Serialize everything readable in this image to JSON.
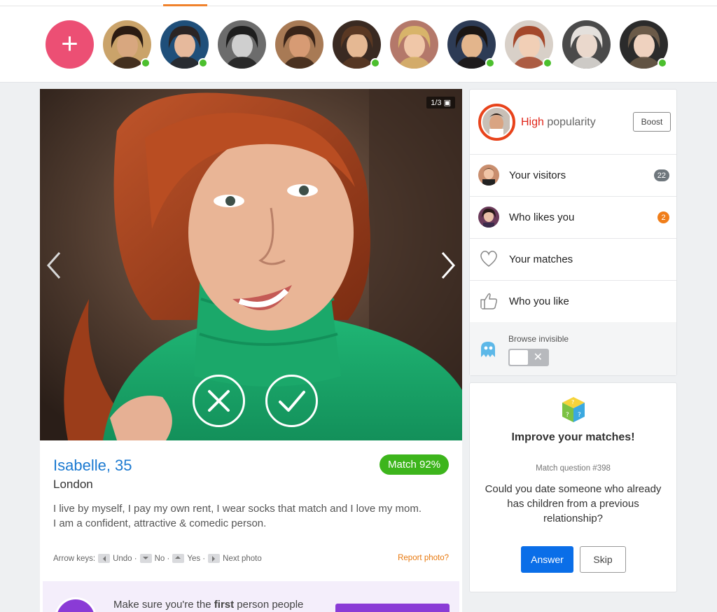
{
  "stories": {
    "add_label": "+",
    "avatars": [
      {
        "name": "avatar-1",
        "online": true,
        "bg": "#caa36a",
        "skin": "#d8a77f",
        "hair": "#2b1b12"
      },
      {
        "name": "avatar-2",
        "online": true,
        "bg": "#1f4f7a",
        "skin": "#e6b99c",
        "hair": "#2a2424"
      },
      {
        "name": "avatar-3",
        "online": false,
        "bg": "#6c6c6c",
        "skin": "#cfcfcf",
        "hair": "#1e1e1e"
      },
      {
        "name": "avatar-4",
        "online": false,
        "bg": "#a87a55",
        "skin": "#d79b74",
        "hair": "#3a2418"
      },
      {
        "name": "avatar-5",
        "online": true,
        "bg": "#3a2a22",
        "skin": "#e5b893",
        "hair": "#5a3823"
      },
      {
        "name": "avatar-6",
        "online": false,
        "bg": "#b4786a",
        "skin": "#f0c7a8",
        "hair": "#d8b46a"
      },
      {
        "name": "avatar-7",
        "online": true,
        "bg": "#2d3b55",
        "skin": "#e3b58c",
        "hair": "#1b1512"
      },
      {
        "name": "avatar-8",
        "online": true,
        "bg": "#d8d0c8",
        "skin": "#f1cfb6",
        "hair": "#a4482b"
      },
      {
        "name": "avatar-9",
        "online": false,
        "bg": "#4a4a4a",
        "skin": "#ead8cc",
        "hair": "#e4e0dc"
      },
      {
        "name": "avatar-10",
        "online": true,
        "bg": "#2b2b2b",
        "skin": "#efd2bf",
        "hair": "#6b5a48"
      }
    ]
  },
  "profile": {
    "photo_counter": "1/3",
    "name": "Isabelle, 35",
    "city": "London",
    "match": "Match 92%",
    "bio_line1": "I live by myself, I pay my own rent, I wear socks that match and I love my mom.",
    "bio_line2": "I am a confident, attractive & comedic person.",
    "keys_label": "Arrow keys:",
    "key_undo": "Undo ·",
    "key_no": "No ·",
    "key_yes": "Yes ·",
    "key_next": "Next photo",
    "report": "Report photo?",
    "promo_pre": "Make sure you're the ",
    "promo_bold": "first",
    "promo_post": " person people"
  },
  "sidebar": {
    "popularity_level": "High",
    "popularity_label": "popularity",
    "boost": "Boost",
    "items": [
      {
        "label": "Your visitors",
        "count": "22",
        "count_color": "#6f777d"
      },
      {
        "label": "Who likes you",
        "count": "2",
        "count_color": "#f07e1a"
      },
      {
        "label": "Your matches",
        "count": "",
        "count_color": ""
      },
      {
        "label": "Who you like",
        "count": "",
        "count_color": ""
      }
    ],
    "invisible_label": "Browse invisible",
    "invisible_icon": "ghost-icon",
    "ghost_color": "#5db8e8"
  },
  "question": {
    "title": "Improve your matches!",
    "number": "Match question #398",
    "text": "Could you date someone who already has children from a previous relationship?",
    "answer": "Answer",
    "skip": "Skip"
  }
}
